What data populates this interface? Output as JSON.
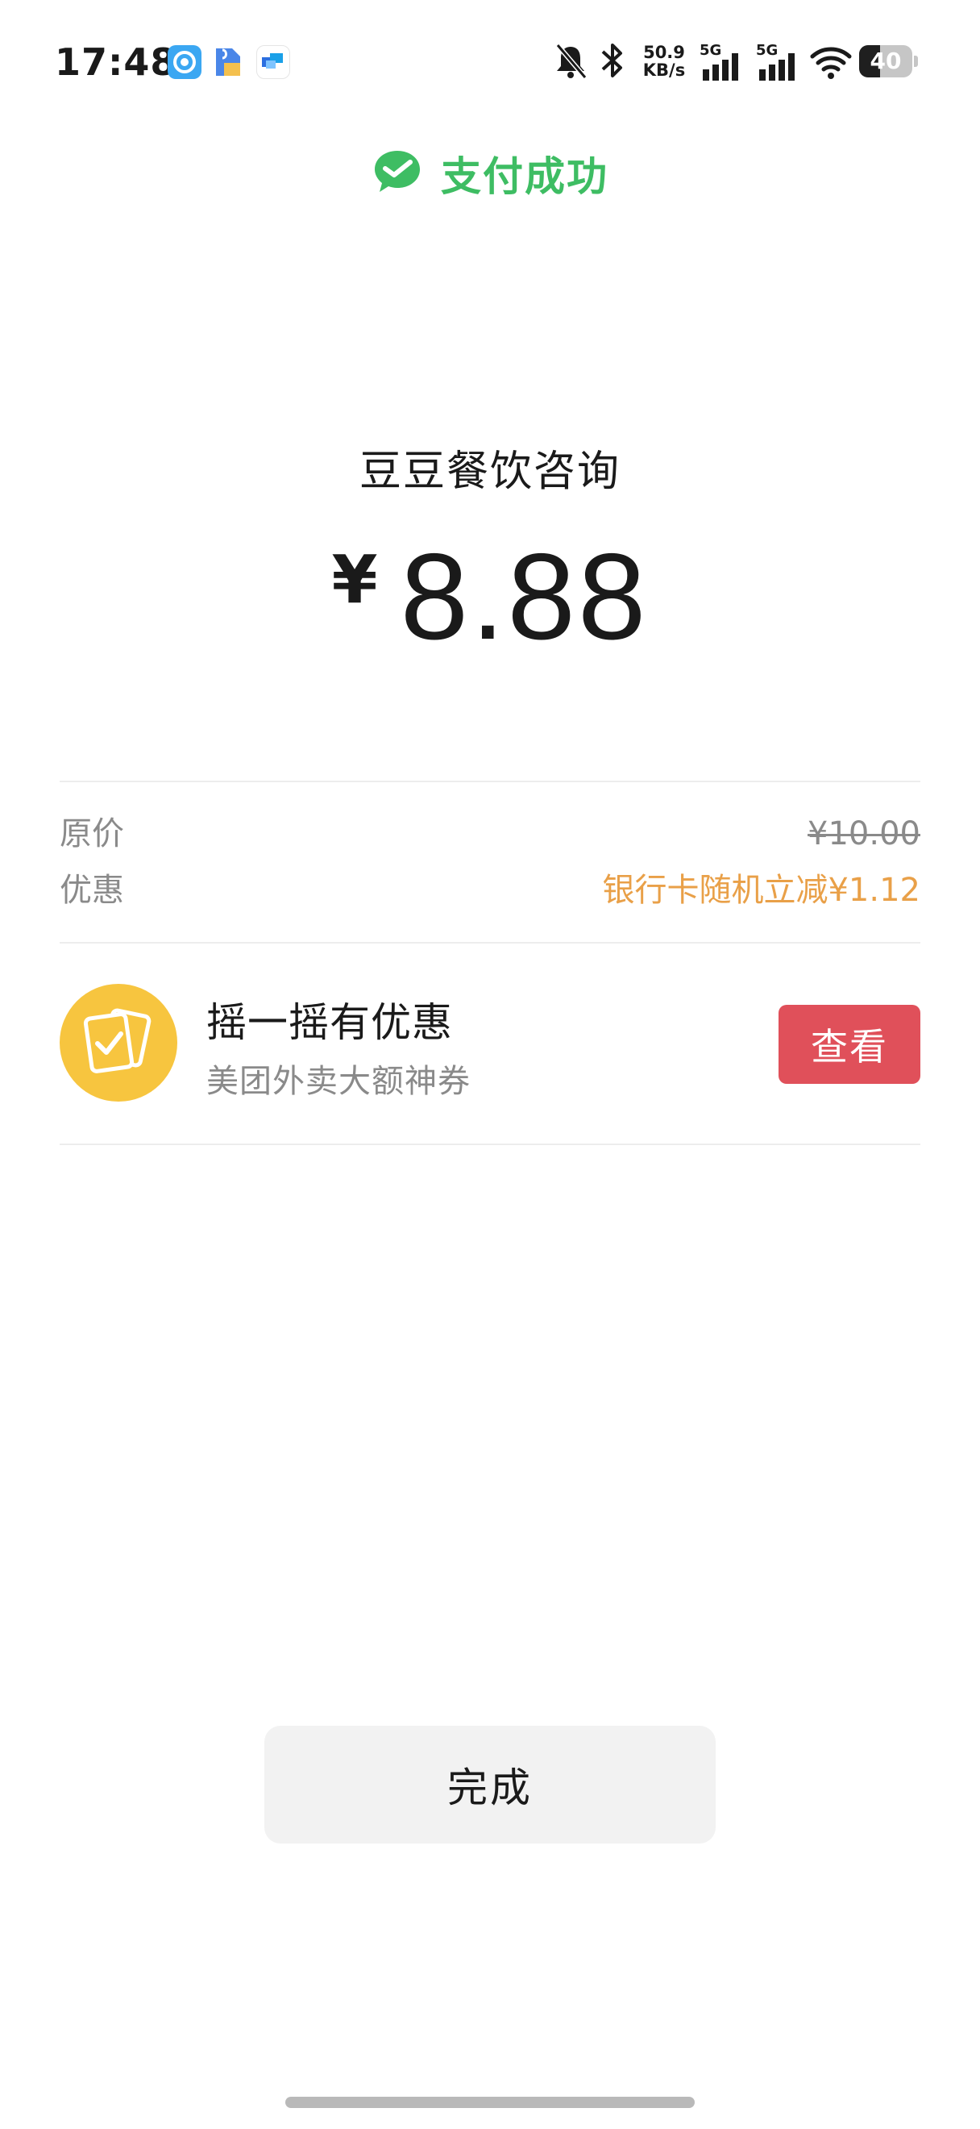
{
  "status_bar": {
    "time": "17:48",
    "network_speed_value": "50.9",
    "network_speed_unit": "KB/s",
    "signal_1_label": "5G",
    "signal_2_label": "5G",
    "battery_level": "40",
    "battery_fraction": 0.4,
    "app_icons": [
      "blue-circle-app-icon",
      "file-app-icon",
      "message-app-icon"
    ],
    "icons": [
      "bell-muted-icon",
      "bluetooth-icon",
      "signal-icon",
      "wifi-icon",
      "battery-icon"
    ]
  },
  "header": {
    "title": "支付成功",
    "icon": "wechat-pay-check-icon",
    "accent_color": "#3ebd63"
  },
  "payment": {
    "merchant": "豆豆餐饮咨询",
    "currency_symbol": "¥",
    "amount": "8.88"
  },
  "details": {
    "original_price_label": "原价",
    "original_price_value": "¥10.00",
    "discount_label": "优惠",
    "discount_value": "银行卡随机立减¥1.12",
    "discount_color": "#e9a048"
  },
  "promo": {
    "icon": "coupon-cards-icon",
    "title": "摇一摇有优惠",
    "subtitle": "美团外卖大额神券",
    "button_label": "查看",
    "button_color": "#e0505a"
  },
  "footer": {
    "done_label": "完成"
  }
}
